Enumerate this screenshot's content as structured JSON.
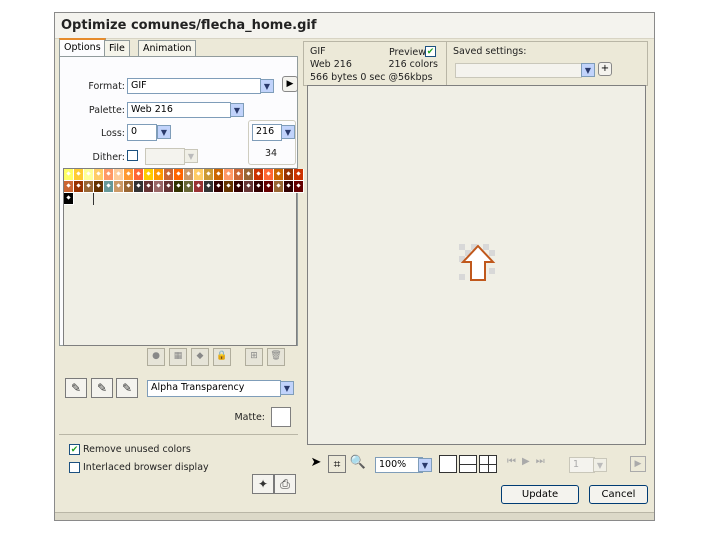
{
  "window": {
    "title": "Optimize comunes/flecha_home.gif"
  },
  "tabs": [
    {
      "label": "Options",
      "active": true
    },
    {
      "label": "File",
      "active": false
    },
    {
      "label": "Animation",
      "active": false
    }
  ],
  "options": {
    "format_label": "Format:",
    "format_value": "GIF",
    "palette_label": "Palette:",
    "palette_value": "Web 216",
    "loss_label": "Loss:",
    "loss_value": "0",
    "colors_value": "216",
    "colors_count": "34",
    "dither_label": "Dither:",
    "dither_checked": false,
    "dither_value": ""
  },
  "palette": {
    "row1": [
      "#ffff66",
      "#ffcc33",
      "#ffff99",
      "#ffcc66",
      "#ff9966",
      "#ffcc99",
      "#ff9933",
      "#ff6633",
      "#ffcc00",
      "#ff9900",
      "#cc6633",
      "#ff6600",
      "#cc9966",
      "#ffcc66",
      "#cc9933",
      "#cc6600",
      "#ff9966",
      "#cc6633",
      "#996633",
      "#cc3300",
      "#ff6633",
      "#cc6600",
      "#993300",
      "#cc3300"
    ],
    "row2": [
      "#cc6633",
      "#993300",
      "#996633",
      "#663300",
      "#669999",
      "#cc9966",
      "#996633",
      "#333333",
      "#663333",
      "#996666",
      "#663333",
      "#333300",
      "#666633",
      "#993333",
      "#333333",
      "#330000",
      "#663300",
      "#330000",
      "#663333",
      "#330000",
      "#660000",
      "#996633",
      "#330000",
      "#660000"
    ],
    "row3": [
      "#000000"
    ]
  },
  "palette_tools": [
    "record-icon",
    "swatch-icon",
    "cube-icon",
    "lock-icon",
    "add-color-icon",
    "trash-icon"
  ],
  "transparency": {
    "value": "Alpha Transparency",
    "matte_label": "Matte:"
  },
  "checkboxes": {
    "remove_unused": {
      "label": "Remove unused colors",
      "checked": true
    },
    "interlaced": {
      "label": "Interlaced browser display",
      "checked": false
    }
  },
  "preview": {
    "format": "GIF",
    "palette": "Web 216",
    "stats": "566 bytes  0 sec @56kbps",
    "preview_label": "Preview",
    "preview_checked": true,
    "colors": "216 colors"
  },
  "saved_settings": {
    "label": "Saved settings:",
    "value": ""
  },
  "bottom_toolbar": {
    "zoom": "100%",
    "frame": "1"
  },
  "buttons": {
    "update": "Update",
    "cancel": "Cancel"
  },
  "colors": {
    "accent": "#e68b2c",
    "arrow_outline": "#c0581c"
  }
}
